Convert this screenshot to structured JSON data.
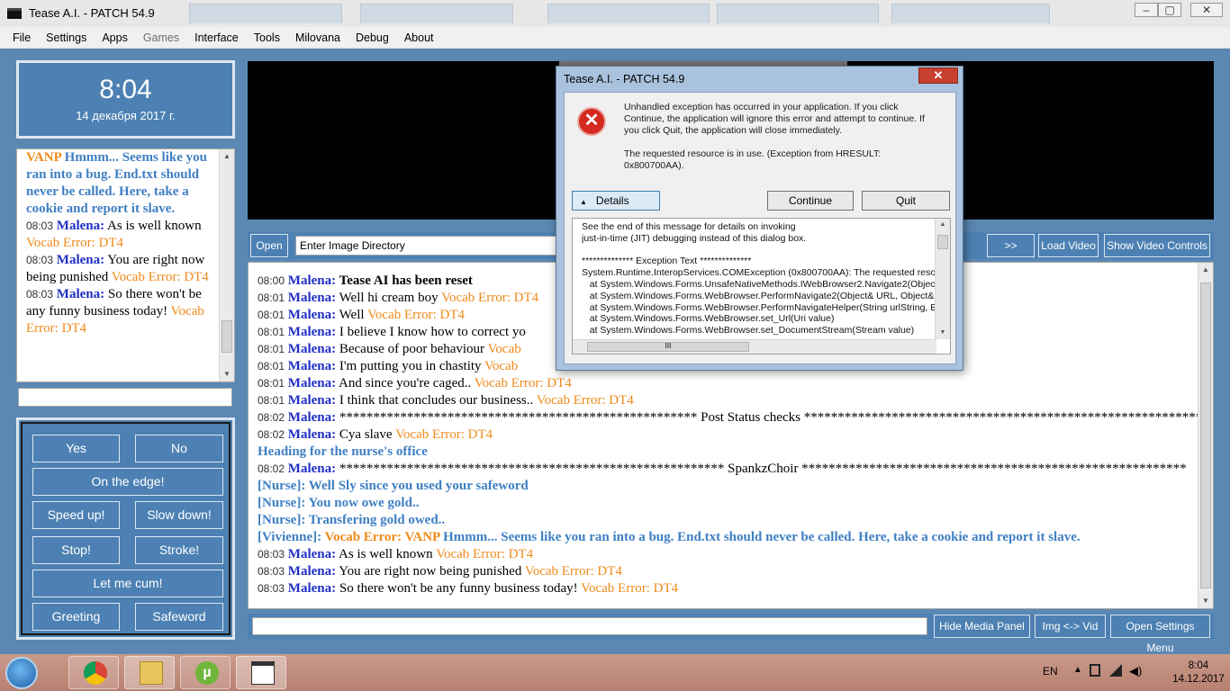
{
  "window": {
    "title": "Tease A.I. - PATCH 54.9"
  },
  "menu": [
    "File",
    "Settings",
    "Apps",
    "Games",
    "Interface",
    "Tools",
    "Milovana",
    "Debug",
    "About"
  ],
  "menu_disabled": [
    "Games"
  ],
  "clock": {
    "time": "8:04",
    "date": "14 декабря 2017 г."
  },
  "side_chat": [
    {
      "type": "cont",
      "text": "VANP",
      "text2": " Hmmm... Seems like you ran into a bug. End.txt should never be called. Here, take a cookie and report it slave."
    },
    {
      "type": "msg",
      "ts": "08:03",
      "name": "Malena:",
      "text": " As is well known ",
      "err": "Vocab Error: DT4"
    },
    {
      "type": "msg",
      "ts": "08:03",
      "name": "Malena:",
      "text": " You are right now being punished ",
      "err": "Vocab Error: DT4"
    },
    {
      "type": "msg",
      "ts": "08:03",
      "name": "Malena:",
      "text": " So there won't be any funny business today! ",
      "err": "Vocab Error: DT4"
    }
  ],
  "buttons": {
    "yes": "Yes",
    "no": "No",
    "edge": "On the edge!",
    "speed_up": "Speed up!",
    "slow_down": "Slow down!",
    "stop": "Stop!",
    "stroke": "Stroke!",
    "let_me_cum": "Let me cum!",
    "greeting": "Greeting",
    "safeword": "Safeword"
  },
  "image_toolbar": {
    "open": "Open",
    "dir_value": "Enter Image Directory",
    "next": ">>",
    "load_video": "Load Video",
    "show_video_controls": "Show Video Controls"
  },
  "main_chat": [
    {
      "type": "msg",
      "ts": "08:00",
      "name": "Malena:",
      "bold": " Tease AI has been reset"
    },
    {
      "type": "msg",
      "ts": "08:01",
      "name": "Malena:",
      "text": " Well hi cream boy ",
      "err": "Vocab Error: DT4"
    },
    {
      "type": "msg",
      "ts": "08:01",
      "name": "Malena:",
      "text": " Well ",
      "err": "Vocab Error: DT4"
    },
    {
      "type": "msg",
      "ts": "08:01",
      "name": "Malena:",
      "text": " I believe I know how to correct yo"
    },
    {
      "type": "msg",
      "ts": "08:01",
      "name": "Malena:",
      "text": " Because of poor behaviour ",
      "err": "Vocab"
    },
    {
      "type": "msg",
      "ts": "08:01",
      "name": "Malena:",
      "text": " I'm putting you in chastity ",
      "err": "Vocab"
    },
    {
      "type": "msg",
      "ts": "08:01",
      "name": "Malena:",
      "text": " And since you're caged.. ",
      "err": "Vocab Error: DT4"
    },
    {
      "type": "msg",
      "ts": "08:01",
      "name": "Malena:",
      "text": " I think that concludes our business.. ",
      "err": "Vocab Error: DT4"
    },
    {
      "type": "msg",
      "ts": "08:02",
      "name": "Malena:",
      "text": " ***************************************************** Post Status checks ************************************************************"
    },
    {
      "type": "msg",
      "ts": "08:02",
      "name": "Malena:",
      "text": " Cya slave ",
      "err": "Vocab Error: DT4"
    },
    {
      "type": "sys",
      "text": "Heading for the nurse's office"
    },
    {
      "type": "msg",
      "ts": "08:02",
      "name": "Malena:",
      "text": " ********************************************************* SpankzChoir *********************************************************"
    },
    {
      "type": "sys",
      "text": "[Nurse]: Well Sly since you used your safeword"
    },
    {
      "type": "sys",
      "text": "[Nurse]: You now owe gold.."
    },
    {
      "type": "sys",
      "text": "[Nurse]: Transfering gold owed.."
    },
    {
      "type": "viv",
      "pre": "[Vivienne]: ",
      "err": "Vocab Error: VANP",
      "post": " Hmmm... Seems like you ran into a bug. End.txt should never be called. Here, take a cookie and report it slave."
    },
    {
      "type": "msg",
      "ts": "08:03",
      "name": "Malena:",
      "text": " As is well known ",
      "err": "Vocab Error: DT4"
    },
    {
      "type": "msg",
      "ts": "08:03",
      "name": "Malena:",
      "text": " You are right now being punished ",
      "err": "Vocab Error: DT4"
    },
    {
      "type": "msg",
      "ts": "08:03",
      "name": "Malena:",
      "text": " So there won't be any funny business today! ",
      "err": "Vocab Error: DT4"
    }
  ],
  "bottom_bar": {
    "hide_media": "Hide Media Panel",
    "img_vid": "Img <-> Vid",
    "open_settings": "Open Settings Menu"
  },
  "dialog": {
    "title": "Tease A.I. - PATCH 54.9",
    "close": "✕",
    "message1": "Unhandled exception has occurred in your application. If you click Continue, the application will ignore this error and attempt to continue. If you click Quit, the application will close immediately.",
    "message2": "The requested resource is in use. (Exception from HRESULT: 0x800700AA).",
    "details": "Details",
    "continue": "Continue",
    "quit": "Quit",
    "details_text": "See the end of this message for details on invoking\njust-in-time (JIT) debugging instead of this dialog box.\n\n************** Exception Text **************\nSystem.Runtime.InteropServices.COMException (0x800700AA): The requested resou\n   at System.Windows.Forms.UnsafeNativeMethods.IWebBrowser2.Navigate2(Object\n   at System.Windows.Forms.WebBrowser.PerformNavigate2(Object& URL, Object& f\n   at System.Windows.Forms.WebBrowser.PerformNavigateHelper(String urlString, Bo\n   at System.Windows.Forms.WebBrowser.set_Url(Uri value)\n   at System.Windows.Forms.WebBrowser.set_DocumentStream(Stream value)",
    "hscroll_thumb": "III"
  },
  "taskbar": {
    "lang": "EN",
    "time": "8:04",
    "date": "14.12.2017"
  },
  "colors": {
    "panel": "#4d81b3",
    "name": "#1f2fc4",
    "error": "#f08a1a",
    "system": "#3e7fc3"
  }
}
